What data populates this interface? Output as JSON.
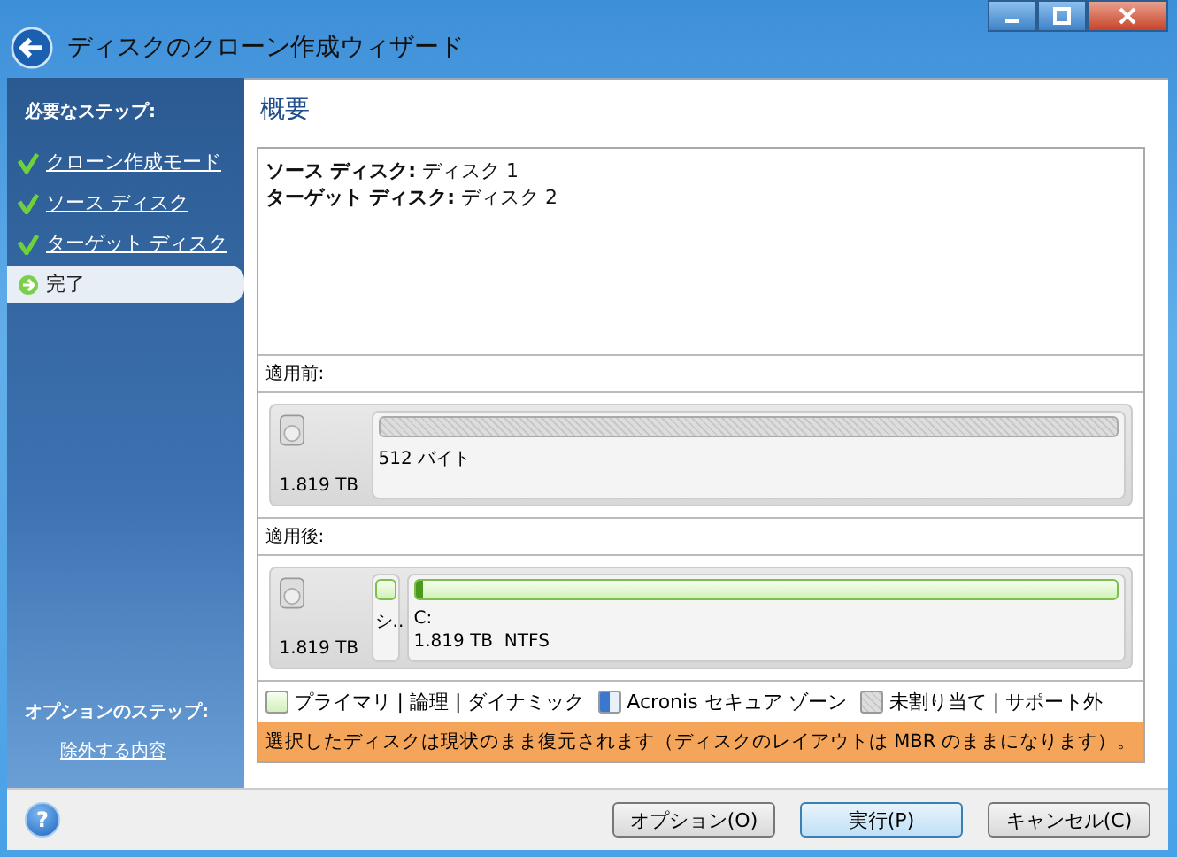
{
  "window": {
    "title": "ディスクのクローン作成ウィザード"
  },
  "sidebar": {
    "required_heading": "必要なステップ:",
    "steps": [
      {
        "label": "クローン作成モード",
        "kind": "done",
        "selected": false
      },
      {
        "label": "ソース ディスク",
        "kind": "done",
        "selected": false
      },
      {
        "label": "ターゲット ディスク",
        "kind": "done",
        "selected": false
      },
      {
        "label": "完了",
        "kind": "current",
        "selected": true
      }
    ],
    "optional_heading": "オプションのステップ:",
    "optional_link": "除外する内容"
  },
  "main": {
    "heading": "概要",
    "summary": [
      "**ソース ディスク:** ディスク 1",
      "**ターゲット ディスク:** ディスク 2"
    ],
    "layouts": [
      {
        "label": "適用前:",
        "disk_size": "1.819 TB",
        "partitions": [
          {
            "kind": "unallocated",
            "name": "512 バイト",
            "wide": true
          }
        ]
      },
      {
        "label": "適用後:",
        "disk_size": "1.819 TB",
        "partitions": [
          {
            "kind": "primary",
            "name": "シ..",
            "wide": false
          },
          {
            "kind": "primary",
            "name": "C:",
            "detail": "1.819 TB  NTFS",
            "wide": true,
            "level": 0.01
          }
        ]
      }
    ],
    "legend": [
      {
        "kind": "primary",
        "label": "プライマリ | 論理 | ダイナミック"
      },
      {
        "kind": "secure",
        "label": "Acronis セキュア ゾーン"
      },
      {
        "kind": "unallocated",
        "label": "未割り当て | サポート外"
      }
    ],
    "notice": "選択したディスクは現状のまま復元されます（ディスクのレイアウトは MBR のままになります）。"
  },
  "help": "?",
  "buttons": [
    {
      "label": "オプション(O)",
      "primary": false
    },
    {
      "label": "実行(P)",
      "primary": true
    },
    {
      "label": "キャンセル(C)",
      "primary": false
    }
  ]
}
